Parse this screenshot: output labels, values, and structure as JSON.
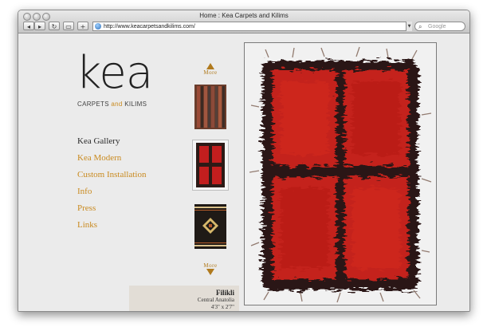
{
  "window": {
    "title": "Home : Kea Carpets and Kilims"
  },
  "toolbar": {
    "back_icon": "back-arrow-icon",
    "forward_icon": "forward-arrow-icon",
    "reload_icon": "reload-icon",
    "bookmarks_icon": "bookmarks-icon",
    "add_icon": "plus-icon",
    "url": "http://www.keacarpetsandkilims.com/",
    "search_placeholder": "Google"
  },
  "logo": {
    "word": "kea",
    "sub_left": "CARPETS ",
    "sub_and": "and",
    "sub_right": " KILIMS",
    "and_color": "#c98a1f"
  },
  "nav": [
    {
      "label": "Kea Gallery",
      "active": true
    },
    {
      "label": "Kea Modern"
    },
    {
      "label": "Custom Installation"
    },
    {
      "label": "Info"
    },
    {
      "label": "Press"
    },
    {
      "label": "Links"
    }
  ],
  "thumbnails": {
    "more_label": "More"
  },
  "caption": {
    "title": "Filikli",
    "region": "Central Anatolia",
    "size": "4'3\" x 2'7\""
  }
}
